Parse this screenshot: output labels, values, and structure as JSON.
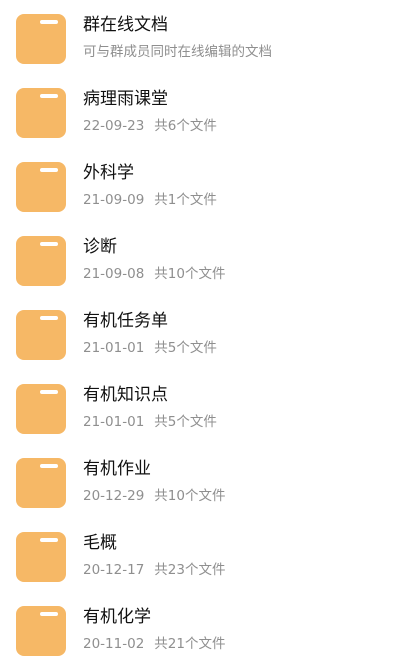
{
  "folders": [
    {
      "title": "群在线文档",
      "subtitle": "可与群成员同时在线编辑的文档"
    },
    {
      "title": "病理雨课堂",
      "date": "22-09-23",
      "count": "共6个文件"
    },
    {
      "title": "外科学",
      "date": "21-09-09",
      "count": "共1个文件"
    },
    {
      "title": "诊断",
      "date": "21-09-08",
      "count": "共10个文件"
    },
    {
      "title": "有机任务单",
      "date": "21-01-01",
      "count": "共5个文件"
    },
    {
      "title": "有机知识点",
      "date": "21-01-01",
      "count": "共5个文件"
    },
    {
      "title": "有机作业",
      "date": "20-12-29",
      "count": "共10个文件"
    },
    {
      "title": "毛概",
      "date": "20-12-17",
      "count": "共23个文件"
    },
    {
      "title": "有机化学",
      "date": "20-11-02",
      "count": "共21个文件"
    }
  ],
  "colors": {
    "folder": "#f6b866",
    "subtitle": "#8f8f8f"
  },
  "icons": {
    "folder": "folder-icon"
  }
}
